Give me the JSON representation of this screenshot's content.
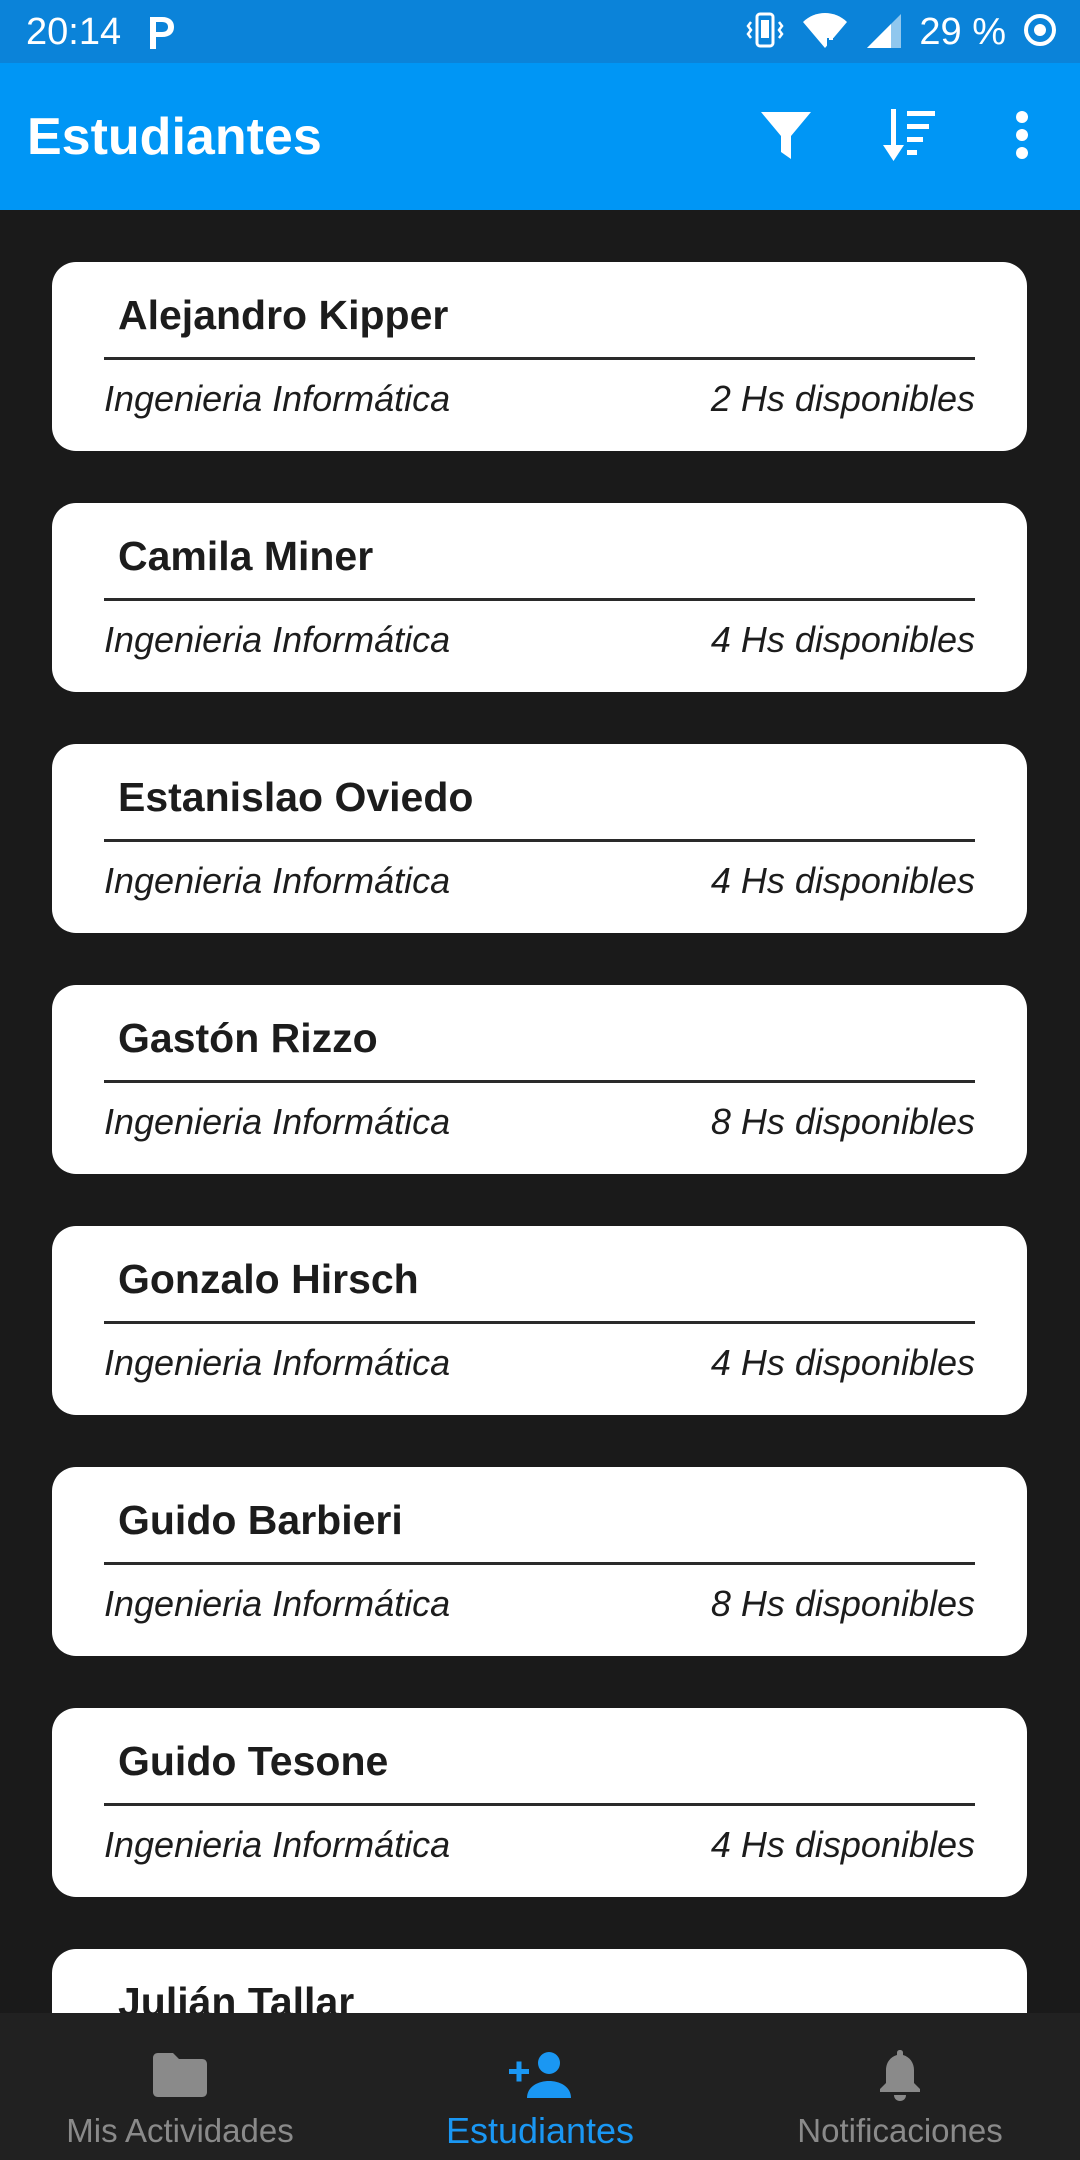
{
  "status_bar": {
    "time": "20:14",
    "battery": "29 %",
    "icons": [
      "parking-icon",
      "vibrate-icon",
      "wifi-icon",
      "signal-icon",
      "battery-saver-icon"
    ]
  },
  "app_bar": {
    "title": "Estudiantes",
    "actions": [
      "filter-icon",
      "sort-icon",
      "more-vert-icon"
    ]
  },
  "students": [
    {
      "name": "Alejandro Kipper",
      "career": "Ingenieria Informática",
      "hours": "2 Hs disponibles"
    },
    {
      "name": "Camila Miner",
      "career": "Ingenieria Informática",
      "hours": "4 Hs disponibles"
    },
    {
      "name": "Estanislao Oviedo",
      "career": "Ingenieria Informática",
      "hours": "4 Hs disponibles"
    },
    {
      "name": "Gastón Rizzo",
      "career": "Ingenieria Informática",
      "hours": "8 Hs disponibles"
    },
    {
      "name": "Gonzalo Hirsch",
      "career": "Ingenieria Informática",
      "hours": "4 Hs disponibles"
    },
    {
      "name": "Guido Barbieri",
      "career": "Ingenieria Informática",
      "hours": "8 Hs disponibles"
    },
    {
      "name": "Guido Tesone",
      "career": "Ingenieria Informática",
      "hours": "4 Hs disponibles"
    },
    {
      "name": "Julián Tallar",
      "career": "",
      "hours": ""
    }
  ],
  "bottom_nav": {
    "items": [
      {
        "label": "Mis Actividades",
        "icon": "folder-icon",
        "active": false
      },
      {
        "label": "Estudiantes",
        "icon": "person-add-icon",
        "active": true
      },
      {
        "label": "Notificaciones",
        "icon": "bell-icon",
        "active": false
      }
    ]
  },
  "colors": {
    "status_bar": "#0b83d9",
    "app_bar": "#0096f5",
    "background": "#1a1a1a",
    "card": "#ffffff",
    "nav_background": "#212121",
    "nav_active": "#1a97f3",
    "nav_inactive": "#8a8a8a"
  }
}
